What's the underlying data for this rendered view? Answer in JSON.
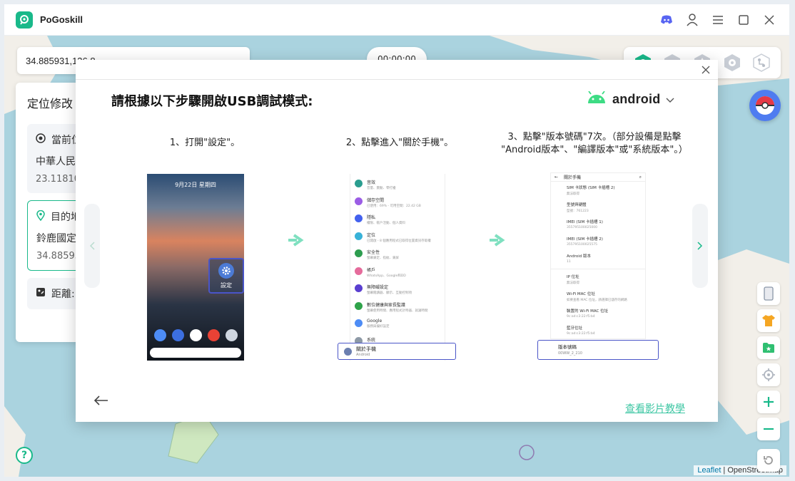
{
  "app": {
    "name": "PoGoskill"
  },
  "search": {
    "coordinate_value": "34.885931,136.8"
  },
  "timer": {
    "value": "00:00:00"
  },
  "left_panel": {
    "title": "定位修改",
    "current": {
      "label": "當前位",
      "name": "中華人民",
      "coord": "23.11810"
    },
    "destination": {
      "label": "目的地",
      "name": "鈴鹿國定",
      "coord": "34.88593"
    },
    "distance": {
      "label": "距離:"
    }
  },
  "modal": {
    "title": "請根據以下步驟開啟USB調試模式:",
    "os": {
      "selected": "android"
    },
    "steps": [
      {
        "title": "1、打開\"設定\"。"
      },
      {
        "title": "2、點擊進入\"關於手機\"。"
      },
      {
        "title_line1": "3、點擊\"版本號碼\"7次。（部分設備是點擊",
        "title_line2": "\"Android版本\"、\"編譯版本\"或\"系統版本\"。）"
      }
    ],
    "phone1": {
      "date": "9月22日 星期四",
      "settings_label": "設定"
    },
    "phone2": {
      "rows": [
        {
          "t1": "音效",
          "t2": "音量、震動、零打擾",
          "color": "#2a9d8f"
        },
        {
          "t1": "儲存空間",
          "t2": "已使用：69% - 可用空間：22.42 GB",
          "color": "#9b5de5"
        },
        {
          "t1": "隱私",
          "t2": "權限、帳戶活動、個人資料",
          "color": "#4361ee"
        },
        {
          "t1": "定位",
          "t2": "已開啟 - 8 個應用程式已取得位置資訊存取權",
          "color": "#38b2d8"
        },
        {
          "t1": "安全性",
          "t2": "螢幕鎖定、指紋、鎖屏",
          "color": "#2d9d4f"
        },
        {
          "t1": "帳戶",
          "t2": "WhatsApp、Google和DD",
          "color": "#e56b9b"
        },
        {
          "t1": "無障礙設定",
          "t2": "螢幕閱讀器、顯示、互動控制項",
          "color": "#5a3fd0"
        },
        {
          "t1": "數位健康與家長監護",
          "t2": "螢幕使用時間、應用程式計時器、就寢時間",
          "color": "#2fa34a"
        },
        {
          "t1": "Google",
          "t2": "服務與偏好設定",
          "color": "#4d8cf5"
        },
        {
          "t1": "系統",
          "t2": "語言、手勢、時間、備份",
          "color": "#8d99a6"
        }
      ],
      "about": {
        "t1": "關於手機",
        "t2": "Android"
      }
    },
    "phone3": {
      "header": "關於手機",
      "rows": [
        {
          "t1": "SIM 卡狀態 (SIM 卡插槽 2)",
          "t2": "無法取得"
        },
        {
          "t1": "型號與硬體",
          "t2": "型號：761223"
        },
        {
          "t1": "IMEI (SIM 卡插槽 1)",
          "t2": "355795100025000"
        },
        {
          "t1": "IMEI (SIM 卡插槽 2)",
          "t2": "355795100025575"
        },
        {
          "t1": "Android 版本",
          "t2": "11"
        },
        {
          "t1": "IP 位址",
          "t2": "無法取得"
        },
        {
          "t1": "Wi-Fi MAC 位址",
          "t2": "如要查看 MAC 位址，請選擇已儲存的網路"
        },
        {
          "t1": "裝置的 Wi-Fi MAC 位址",
          "t2": "9c:ad:c3:22:f5:b4"
        },
        {
          "t1": "藍牙位址",
          "t2": "9c:ad:c3:22:f5:b4"
        }
      ],
      "build": {
        "t1": "版本號碼",
        "t2": "00WW_2_210"
      }
    },
    "video_link": "查看影片教學"
  },
  "attribution": {
    "leaflet": "Leaflet",
    "rest": " | OpenStreetMap"
  },
  "colors": {
    "accent": "#19b98a",
    "highlight": "#4a55c8",
    "link": "#3fc7a4"
  }
}
